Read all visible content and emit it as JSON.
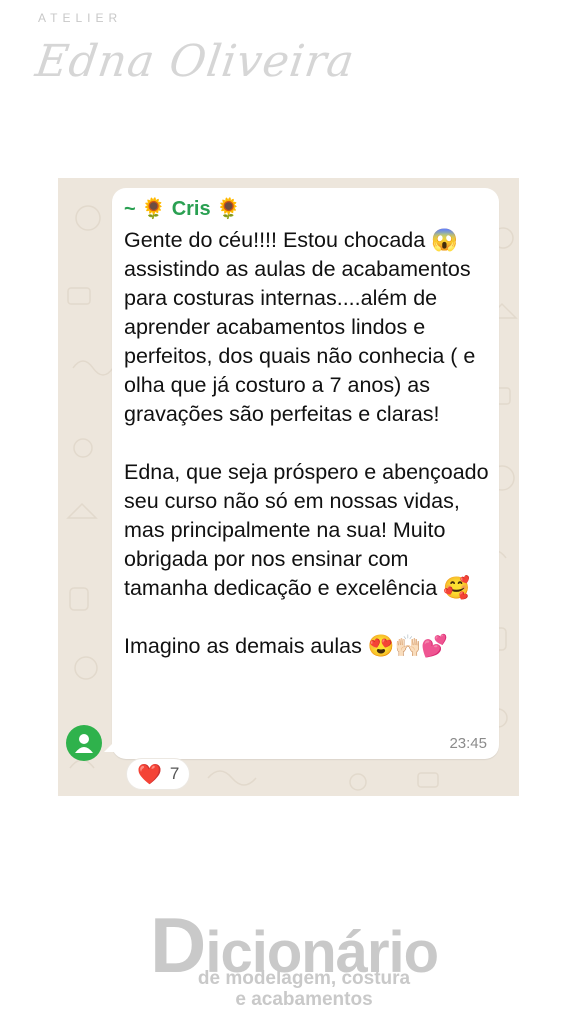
{
  "header": {
    "atelier": "ATELIER",
    "brand_name": "Edna Oliveira"
  },
  "message": {
    "sender": "~ 🌻 Cris 🌻",
    "text": "Gente do céu!!!! Estou chocada 😱 assistindo as aulas de acabamentos para costuras internas....além de aprender acabamentos lindos e perfeitos, dos quais não conhecia ( e olha que já costuro a 7 anos) as gravações são perfeitas e claras!\n\nEdna, que seja próspero e abençoado seu curso não só em nossas vidas, mas principalmente na sua! Muito obrigada por nos ensinar com tamanha dedicação e excelência 🥰\n\nImagino as demais aulas 😍🙌🏻💕",
    "time": "23:45",
    "reaction_emoji": "❤️",
    "reaction_count": "7"
  },
  "footer": {
    "title_cap": "D",
    "title_rest": "icionário",
    "subtitle_line1": "de modelagem, costura",
    "subtitle_line2": "e acabamentos"
  },
  "colors": {
    "sender": "#2aa052",
    "chat_background": "#ede6dc",
    "avatar": "#2fb24c",
    "heart": "#e0242f"
  },
  "icons": [
    "avatar-person-icon",
    "heart-icon"
  ]
}
